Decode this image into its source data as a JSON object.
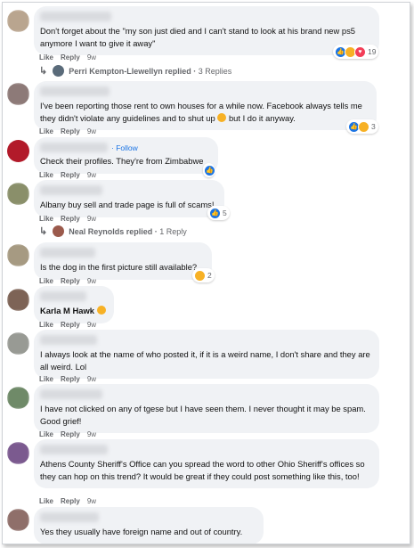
{
  "comments": [
    {
      "text": "Don't forget about the \"my son just died and I can't stand to look at his brand new ps5 anymore I want to give it away\"",
      "like": "Like",
      "reply": "Reply",
      "time": "9w",
      "reaction_count": "19"
    },
    {
      "text": "I've been reporting those rent to own houses for a while now. Facebook always tells me they didn't violate any guidelines and to shut up",
      "text_tail": "but I do it anyway.",
      "like": "Like",
      "reply": "Reply",
      "time": "9w",
      "reaction_count": "3"
    },
    {
      "follow": "Follow",
      "text": "Check their profiles. They're from Zimbabwe",
      "like": "Like",
      "reply": "Reply",
      "time": "9w"
    },
    {
      "text": "Albany buy sell and trade page is full of scams!",
      "like": "Like",
      "reply": "Reply",
      "time": "9w",
      "reaction_count": "5"
    },
    {
      "text": "Is the dog in the first picture still available?",
      "like": "Like",
      "reply": "Reply",
      "time": "9w",
      "reaction_count": "2"
    },
    {
      "text": "Karla M Hawk",
      "like": "Like",
      "reply": "Reply",
      "time": "9w"
    },
    {
      "text": "I always look at the name of who posted it, if it is a weird name, I don't share and they are all weird. Lol",
      "like": "Like",
      "reply": "Reply",
      "time": "9w"
    },
    {
      "text": "I have not clicked on any of tgese but I have seen them. I never thought it may be spam. Good grief!",
      "like": "Like",
      "reply": "Reply",
      "time": "9w"
    },
    {
      "text": "Athens County Sheriff's Office can you spread the word to other Ohio Sheriff's offices so they can hop on this trend? It would be great if they could post something like this, too!",
      "like": "Like",
      "reply": "Reply",
      "time": "9w"
    },
    {
      "text": "Yes they usually have foreign name and out of country.",
      "like": "Like",
      "reply": "Reply",
      "time": "9w"
    }
  ],
  "replies": [
    {
      "name": "Perri Kempton-Llewellyn replied",
      "sep": "·",
      "count": "3 Replies"
    },
    {
      "name": "Neal Reynolds replied",
      "sep": "·",
      "count": "1 Reply"
    }
  ],
  "colors": {
    "bubble": "#f0f2f5",
    "meta": "#65676b",
    "link": "#1b74e4"
  }
}
